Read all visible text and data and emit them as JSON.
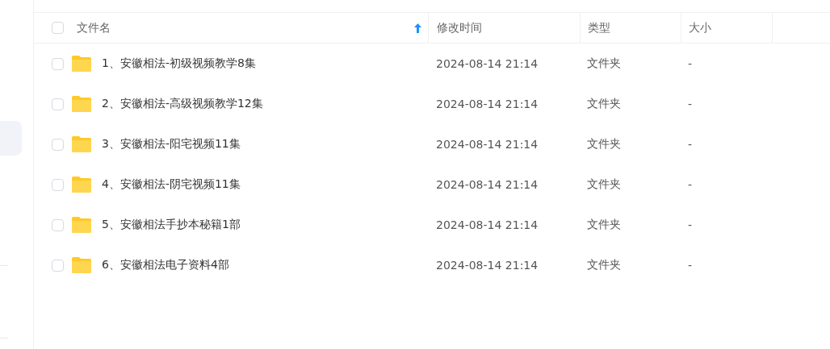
{
  "table": {
    "select_all": {
      "checked": false
    },
    "columns": [
      {
        "label": "文件名",
        "sorted": true
      },
      {
        "label": "修改时间",
        "sorted": false
      },
      {
        "label": "类型",
        "sorted": false
      },
      {
        "label": "大小",
        "sorted": false
      }
    ],
    "rows": [
      {
        "checked": false,
        "name": "1、安徽相法-初级视频教学8集",
        "modified": "2024-08-14 21:14",
        "type": "文件夹",
        "size": "-"
      },
      {
        "checked": false,
        "name": "2、安徽相法-高级视频教学12集",
        "modified": "2024-08-14 21:14",
        "type": "文件夹",
        "size": "-"
      },
      {
        "checked": false,
        "name": "3、安徽相法-阳宅视频11集",
        "modified": "2024-08-14 21:14",
        "type": "文件夹",
        "size": "-"
      },
      {
        "checked": false,
        "name": "4、安徽相法-阴宅视频11集",
        "modified": "2024-08-14 21:14",
        "type": "文件夹",
        "size": "-"
      },
      {
        "checked": false,
        "name": "5、安徽相法手抄本秘籍1部",
        "modified": "2024-08-14 21:14",
        "type": "文件夹",
        "size": "-"
      },
      {
        "checked": false,
        "name": "6、安徽相法电子资料4部",
        "modified": "2024-08-14 21:14",
        "type": "文件夹",
        "size": "-"
      }
    ]
  }
}
